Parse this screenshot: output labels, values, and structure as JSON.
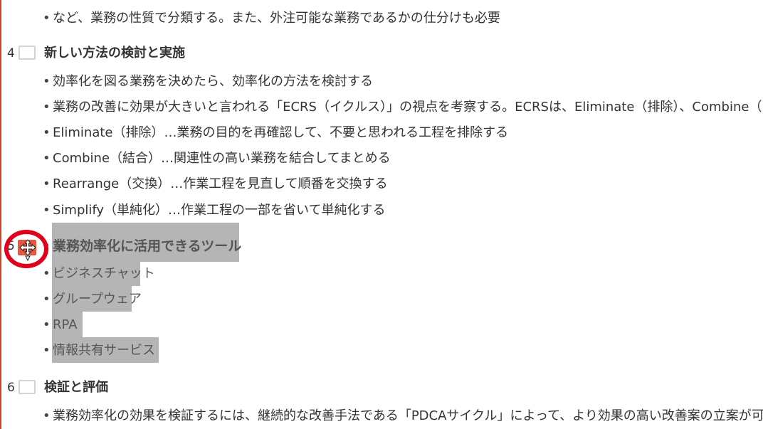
{
  "sections": [
    {
      "bullets": [
        "など、業務の性質で分類する。また、外注可能な業務であるかの仕分けも必要"
      ]
    },
    {
      "number": "4",
      "title": "新しい方法の検討と実施",
      "bullets": [
        "効率化を図る業務を決めたら、効率化の方法を検討する",
        "業務の改善に効果が大きいと言われる「ECRS（イクルス）」の視点を考察する。ECRSは、Eliminate（排除）、Combine（",
        "Eliminate（排除）…業務の目的を再確認して、不要と思われる工程を排除する",
        "Combine（結合）…関連性の高い業務を結合してまとめる",
        "Rearrange（交換）…作業工程を見直して順番を交換する",
        "Simplify（単純化）…作業工程の一部を省いて単純化する"
      ]
    },
    {
      "number": "5",
      "title": "業務効率化に活用できるツール",
      "bullets": [
        "ビジネスチャット",
        "グループウェア",
        "RPA",
        "情報共有サービス"
      ]
    },
    {
      "number": "6",
      "title": "検証と評価",
      "bullets": [
        "業務効率化の効果を検証するには、継続的な改善手法である「PDCAサイクル」によって、より効果の高い改善案の立案が可能と"
      ]
    }
  ],
  "bullet_char": "•",
  "colors": {
    "selection": "#b5b5b5",
    "thumbnail_selected": "#e6573e",
    "annotation_circle": "#e0001b",
    "edge": "#c9472b"
  },
  "cursor_icon": "move-cursor-icon"
}
